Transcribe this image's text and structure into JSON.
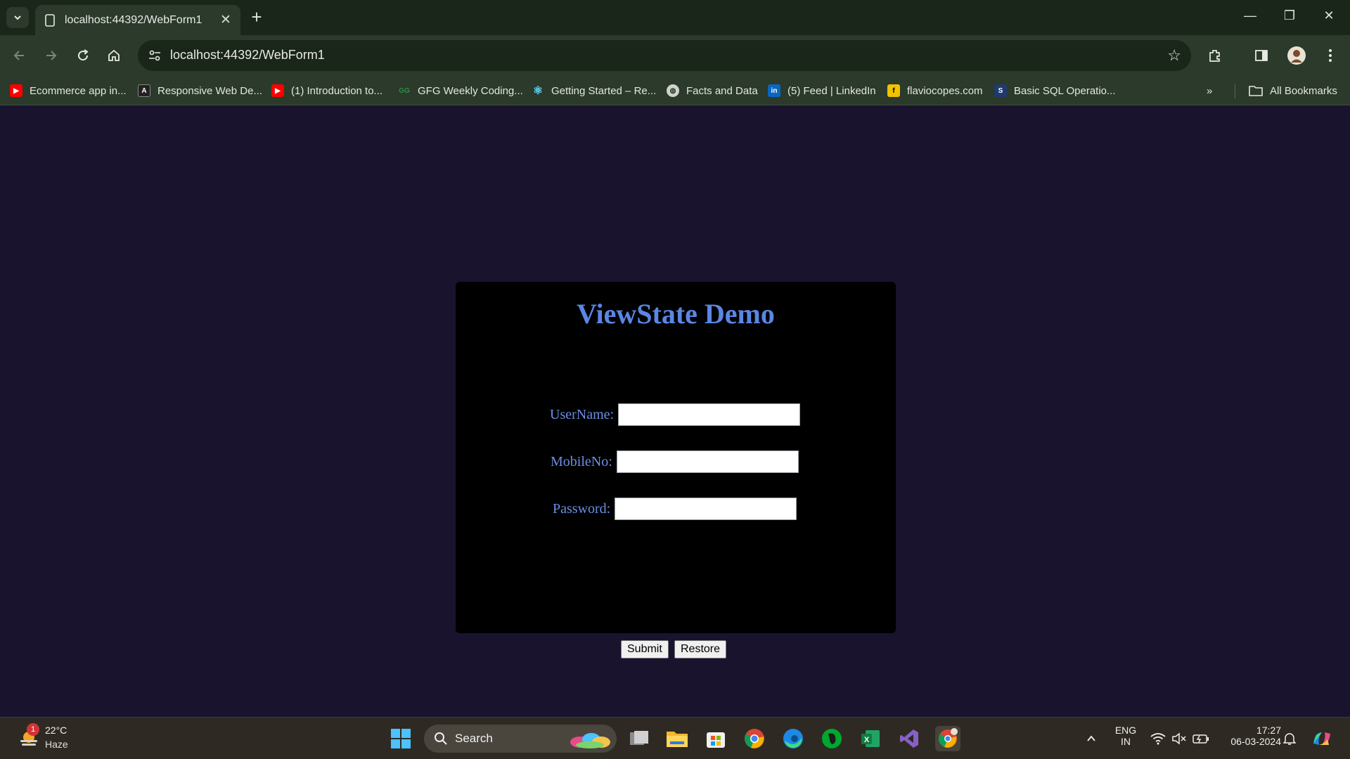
{
  "browser": {
    "tab_title": "localhost:44392/WebForm1",
    "url": "localhost:44392/WebForm1",
    "bookmarks": [
      {
        "label": "Ecommerce app in...",
        "icon": "youtube-icon",
        "color": "#ff0000"
      },
      {
        "label": "Responsive Web De...",
        "icon": "a-logo-icon",
        "color": "#222222"
      },
      {
        "label": "(1) Introduction to...",
        "icon": "youtube-icon",
        "color": "#ff0000"
      },
      {
        "label": "GFG Weekly Coding...",
        "icon": "gfg-icon",
        "color": "#2f8d46"
      },
      {
        "label": "Getting Started – Re...",
        "icon": "react-icon",
        "color": "#61dafb"
      },
      {
        "label": "Facts and Data",
        "icon": "globe-icon",
        "color": "#cfd3cc"
      },
      {
        "label": "(5) Feed | LinkedIn",
        "icon": "linkedin-icon",
        "color": "#0a66c2"
      },
      {
        "label": "flaviocopes.com",
        "icon": "flavio-icon",
        "color": "#f2c200"
      },
      {
        "label": "Basic SQL Operatio...",
        "icon": "sql-icon",
        "color": "#1e3a6e"
      }
    ],
    "all_bookmarks_label": "All Bookmarks"
  },
  "form": {
    "heading": "ViewState Demo",
    "username_label": "UserName:",
    "mobile_label": "MobileNo:",
    "password_label": "Password:",
    "username_value": "",
    "mobile_value": "",
    "password_value": "",
    "submit_label": "Submit",
    "restore_label": "Restore"
  },
  "taskbar": {
    "weather_temp": "22°C",
    "weather_cond": "Haze",
    "weather_badge": "1",
    "search_label": "Search",
    "lang_top": "ENG",
    "lang_bottom": "IN",
    "time": "17:27",
    "date": "06-03-2024"
  },
  "colors": {
    "page_bg": "#19132e",
    "card_bg": "#000000",
    "heading": "#5a86e4",
    "label": "#6a8fe6",
    "chrome": "#2b3a2b"
  }
}
